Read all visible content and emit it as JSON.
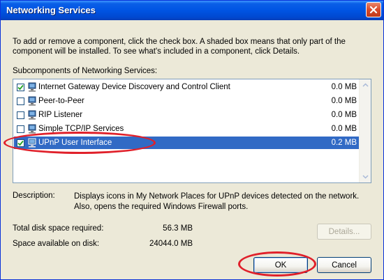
{
  "window": {
    "title": "Networking Services"
  },
  "intro_text": "To add or remove a component, click the check box. A shaded box means that only part of the component will be installed. To see what's included in a component, click Details.",
  "subcomponents_label": "Subcomponents of Networking Services:",
  "items": [
    {
      "label": "Internet Gateway Device Discovery and Control Client",
      "size": "0.0 MB",
      "checked": true,
      "selected": false
    },
    {
      "label": "Peer-to-Peer",
      "size": "0.0 MB",
      "checked": false,
      "selected": false
    },
    {
      "label": "RIP Listener",
      "size": "0.0 MB",
      "checked": false,
      "selected": false
    },
    {
      "label": "Simple TCP/IP Services",
      "size": "0.0 MB",
      "checked": false,
      "selected": false
    },
    {
      "label": "UPnP User Interface",
      "size": "0.2 MB",
      "checked": true,
      "selected": true
    }
  ],
  "description": {
    "label": "Description:",
    "text": "Displays icons in My Network Places for UPnP devices detected on the network. Also, opens the required Windows Firewall ports."
  },
  "disk": {
    "required_label": "Total disk space required:",
    "required_value": "56.3 MB",
    "available_label": "Space available on disk:",
    "available_value": "24044.0 MB"
  },
  "buttons": {
    "details": "Details...",
    "ok": "OK",
    "cancel": "Cancel"
  },
  "colors": {
    "titlebar": "#0054E3",
    "selection": "#316AC5",
    "annotation": "#E0202A"
  }
}
